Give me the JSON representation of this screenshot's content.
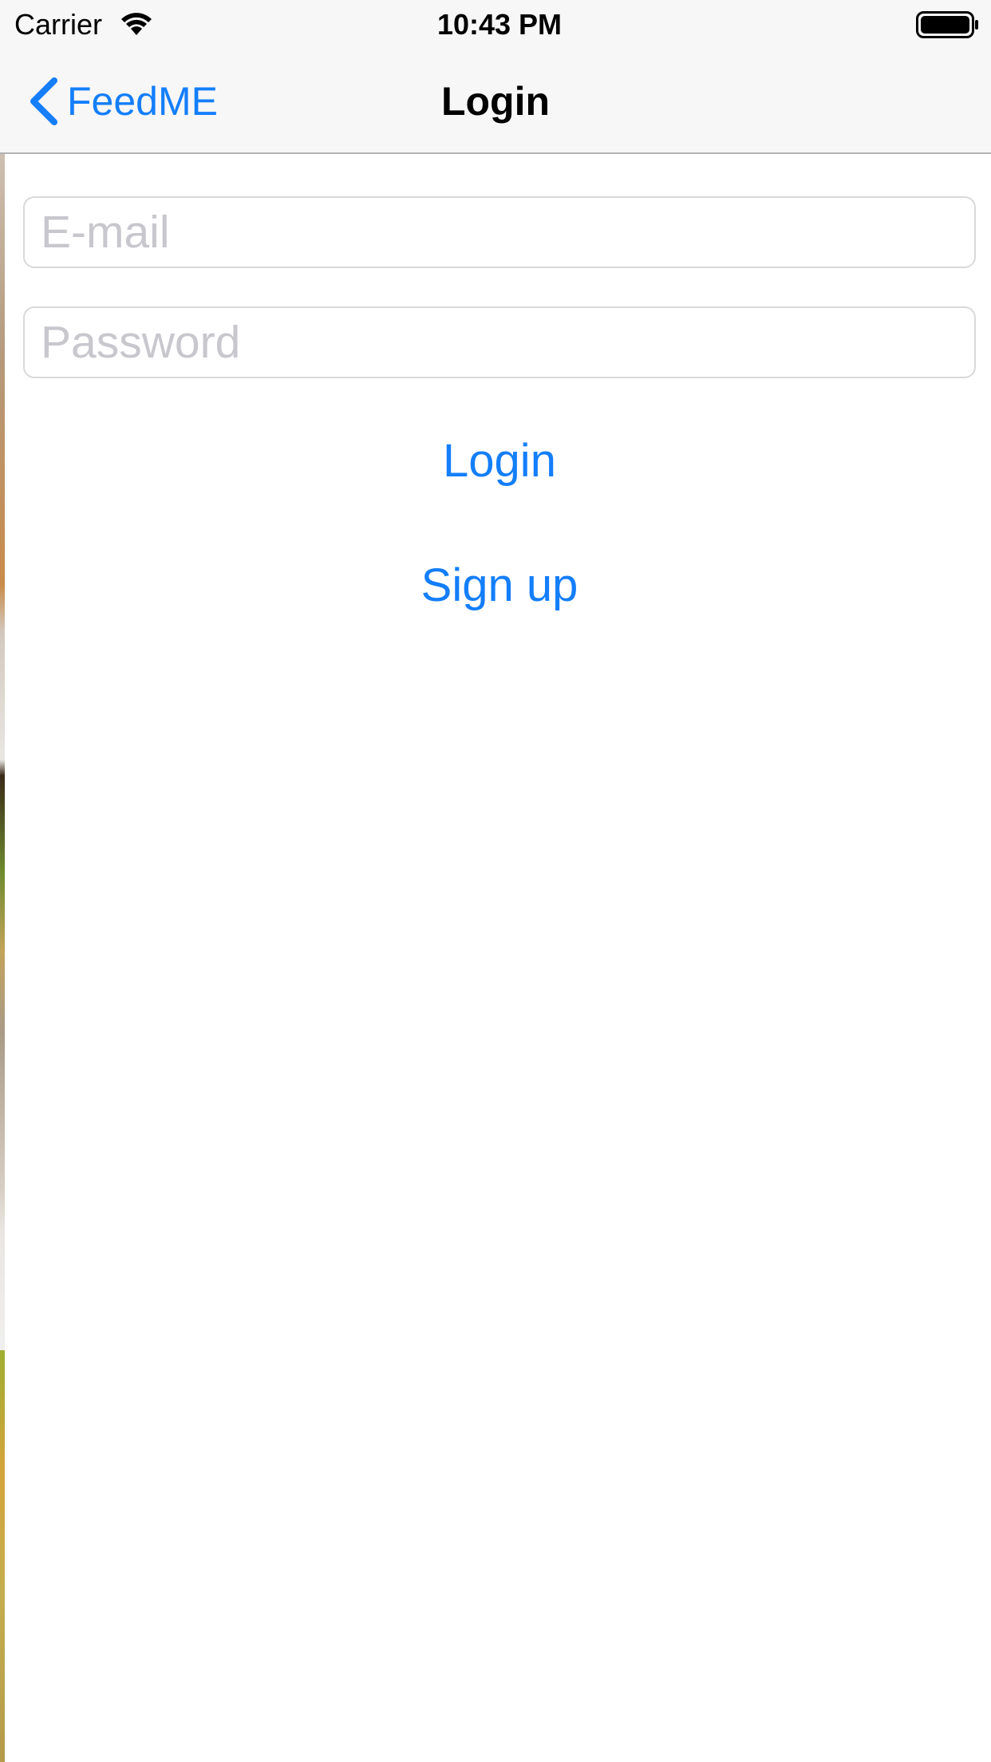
{
  "status_bar": {
    "carrier": "Carrier",
    "time": "10:43 PM",
    "wifi_icon": "wifi-icon",
    "battery_icon": "battery-icon"
  },
  "nav": {
    "back_label": "FeedME",
    "back_icon": "chevron-left-icon",
    "title": "Login"
  },
  "form": {
    "email": {
      "value": "",
      "placeholder": "E-mail"
    },
    "password": {
      "value": "",
      "placeholder": "Password"
    },
    "login_label": "Login",
    "signup_label": "Sign up"
  },
  "colors": {
    "accent": "#147efb",
    "bar_background": "#f7f7f7",
    "placeholder": "#c7c7cd",
    "field_border": "#d9d9d9"
  }
}
